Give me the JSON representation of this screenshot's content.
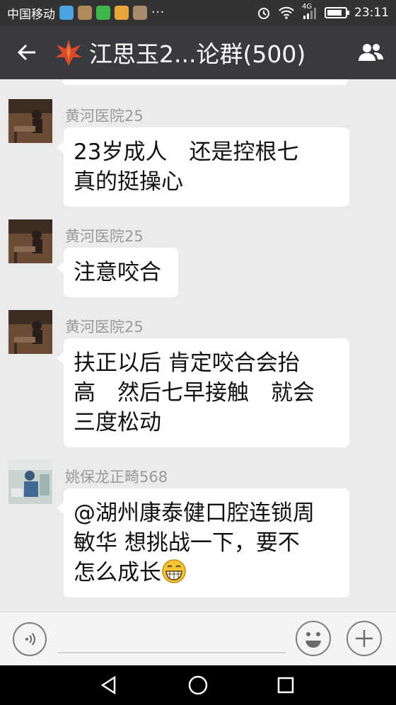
{
  "status_bar": {
    "carrier": "中国移动",
    "ellipsis": "···",
    "network": "4G",
    "time": "23:11",
    "battery_level": 0.85,
    "app_icons": [
      "browser-app-icon",
      "package-app-icon",
      "wechat-app-icon",
      "mail-app-icon",
      "gallery-app-icon"
    ]
  },
  "header": {
    "title": "江思玉2...论群(500)"
  },
  "messages": [
    {
      "sender": "黄河医院25",
      "lines": [
        "23岁成人　还是控根七",
        "真的挺操心"
      ]
    },
    {
      "sender": "黄河医院25",
      "lines": [
        "注意咬合"
      ]
    },
    {
      "sender": "黄河医院25",
      "lines": [
        "扶正以后 肯定咬合会抬",
        "高　然后七早接触　就会",
        "三度松动"
      ]
    },
    {
      "sender": "姚保龙正畸568",
      "lines": [
        "@湖州康泰健口腔连锁周",
        "敏华 想挑战一下，要不",
        "怎么成长"
      ],
      "trailing_emoji": "grinning-face"
    }
  ],
  "colors": {
    "status_bar": "#333333",
    "title_bar": "#393a3f",
    "chat_background": "#ebebeb",
    "bubble": "#ffffff",
    "sender_name": "#9a9a9a"
  }
}
